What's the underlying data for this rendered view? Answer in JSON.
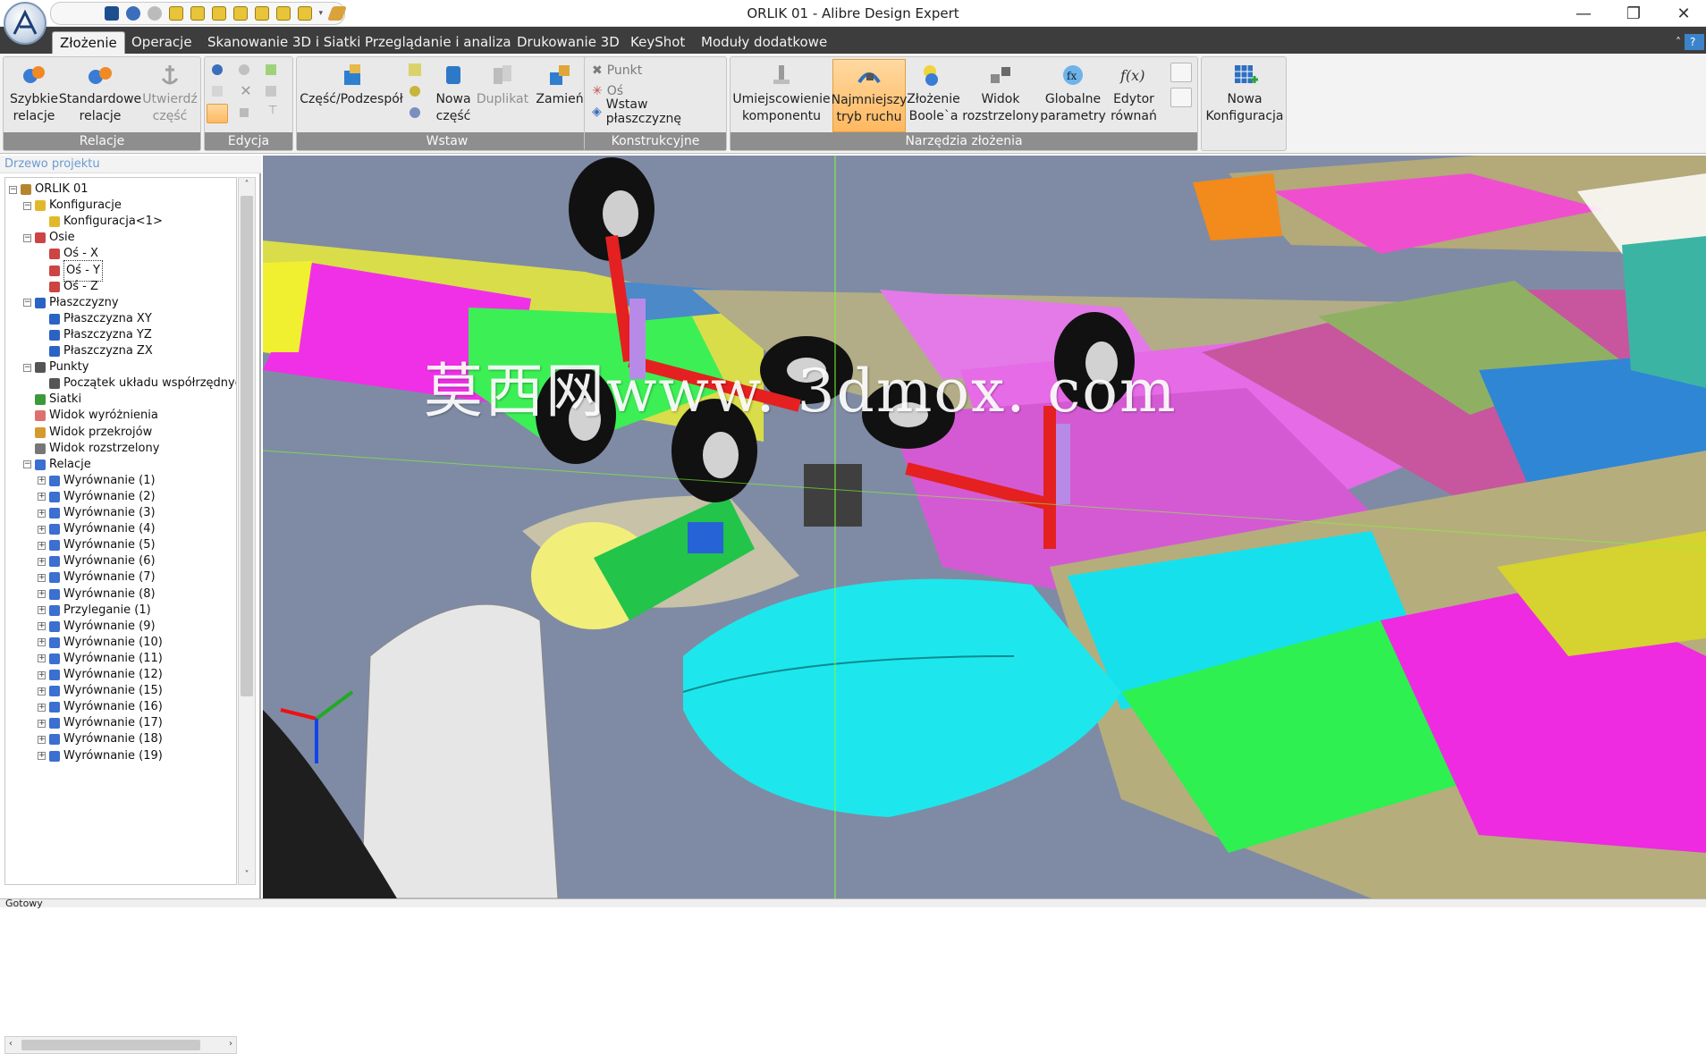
{
  "window": {
    "title": "ORLIK 01 - Alibre Design Expert",
    "minimize_glyph": "—",
    "maximize_glyph": "❐",
    "close_glyph": "✕"
  },
  "menu": {
    "tabs": [
      {
        "label": "Złożenie",
        "active": true
      },
      {
        "label": "Operacje"
      },
      {
        "label": "Skanowanie 3D i Siatki"
      },
      {
        "label": "Przeglądanie i analiza"
      },
      {
        "label": "Drukowanie 3D"
      },
      {
        "label": "KeyShot"
      },
      {
        "label": "Moduły dodatkowe"
      }
    ],
    "collapse_glyph": "˄",
    "help_glyph": "?"
  },
  "ribbon": {
    "groups": {
      "relacje": {
        "title": "Relacje",
        "quick": "Szybkie relacje",
        "standard": "Standardowe relacje",
        "anchor": "Utwierdź część"
      },
      "edycja": {
        "title": "Edycja"
      },
      "wstaw": {
        "title": "Wstaw",
        "part_subassembly": "Część/Podzespół",
        "new_part": "Nowa część",
        "duplicate": "Duplikat",
        "replace": "Zamień"
      },
      "konstrukcyjne": {
        "title": "Konstrukcyjne",
        "point": "Punkt",
        "axis": "Oś",
        "plane": "Wstaw płaszczyznę"
      },
      "narzedzia": {
        "title": "Narzędzia złożenia",
        "place": "Umiejscowienie komponentu",
        "min_motion": "Najmniejszy tryb ruchu",
        "boolean": "Złożenie Boole`a",
        "exploded": "Widok rozstrzelony",
        "global": "Globalne parametry",
        "equation": "Edytor równań"
      },
      "konfiguracja": {
        "new_config": "Nowa Konfiguracja"
      }
    }
  },
  "panel": {
    "title": "Drzewo projektu",
    "tree": [
      {
        "label": "ORLIK 01",
        "level": 0,
        "expander": "−",
        "icon": "assembly-icon"
      },
      {
        "label": "Konfiguracje",
        "level": 1,
        "expander": "−",
        "icon": "configuration-icon"
      },
      {
        "label": "Konfiguracja<1>",
        "level": 2,
        "icon": "configuration-icon"
      },
      {
        "label": "Osie",
        "level": 1,
        "expander": "−",
        "icon": "axis-icon"
      },
      {
        "label": "Oś - X",
        "level": 2,
        "icon": "axis-icon"
      },
      {
        "label": "Oś - Y",
        "level": 2,
        "icon": "axis-icon",
        "selected": true
      },
      {
        "label": "Oś - Z",
        "level": 2,
        "icon": "axis-icon"
      },
      {
        "label": "Płaszczyzny",
        "level": 1,
        "expander": "−",
        "icon": "plane-icon"
      },
      {
        "label": "Płaszczyzna XY",
        "level": 2,
        "icon": "plane-icon"
      },
      {
        "label": "Płaszczyzna YZ",
        "level": 2,
        "icon": "plane-icon"
      },
      {
        "label": "Płaszczyzna ZX",
        "level": 2,
        "icon": "plane-icon"
      },
      {
        "label": "Punkty",
        "level": 1,
        "expander": "−",
        "icon": "point-icon"
      },
      {
        "label": "Początek układu współrzędnyc",
        "level": 2,
        "icon": "point-icon"
      },
      {
        "label": "Siatki",
        "level": 1,
        "icon": "mesh-icon"
      },
      {
        "label": "Widok wyróżnienia",
        "level": 1,
        "icon": "highlight-view-icon"
      },
      {
        "label": "Widok przekrojów",
        "level": 1,
        "icon": "section-view-icon"
      },
      {
        "label": "Widok rozstrzelony",
        "level": 1,
        "icon": "exploded-view-icon"
      },
      {
        "label": "Relacje",
        "level": 1,
        "expander": "−",
        "icon": "constraint-icon"
      },
      {
        "label": "Wyrównanie (1)",
        "level": 2,
        "expander": "+",
        "icon": "constraint-icon"
      },
      {
        "label": "Wyrównanie (2)",
        "level": 2,
        "expander": "+",
        "icon": "constraint-icon"
      },
      {
        "label": "Wyrównanie (3)",
        "level": 2,
        "expander": "+",
        "icon": "constraint-icon"
      },
      {
        "label": "Wyrównanie (4)",
        "level": 2,
        "expander": "+",
        "icon": "constraint-icon"
      },
      {
        "label": "Wyrównanie (5)",
        "level": 2,
        "expander": "+",
        "icon": "constraint-icon"
      },
      {
        "label": "Wyrównanie (6)",
        "level": 2,
        "expander": "+",
        "icon": "constraint-icon"
      },
      {
        "label": "Wyrównanie (7)",
        "level": 2,
        "expander": "+",
        "icon": "constraint-icon"
      },
      {
        "label": "Wyrównanie (8)",
        "level": 2,
        "expander": "+",
        "icon": "constraint-icon"
      },
      {
        "label": "Przyleganie (1)",
        "level": 2,
        "expander": "+",
        "icon": "constraint-icon"
      },
      {
        "label": "Wyrównanie (9)",
        "level": 2,
        "expander": "+",
        "icon": "constraint-icon"
      },
      {
        "label": "Wyrównanie (10)",
        "level": 2,
        "expander": "+",
        "icon": "constraint-icon"
      },
      {
        "label": "Wyrównanie (11)",
        "level": 2,
        "expander": "+",
        "icon": "constraint-icon"
      },
      {
        "label": "Wyrównanie (12)",
        "level": 2,
        "expander": "+",
        "icon": "constraint-icon"
      },
      {
        "label": "Wyrównanie (15)",
        "level": 2,
        "expander": "+",
        "icon": "constraint-icon"
      },
      {
        "label": "Wyrównanie (16)",
        "level": 2,
        "expander": "+",
        "icon": "constraint-icon"
      },
      {
        "label": "Wyrównanie (17)",
        "level": 2,
        "expander": "+",
        "icon": "constraint-icon"
      },
      {
        "label": "Wyrównanie (18)",
        "level": 2,
        "expander": "+",
        "icon": "constraint-icon"
      },
      {
        "label": "Wyrównanie (19)",
        "level": 2,
        "expander": "+",
        "icon": "constraint-icon"
      }
    ]
  },
  "viewport": {
    "watermark": "莫西网www. 3dmox. com"
  },
  "status": {
    "text": "Gotowy"
  },
  "colors": {
    "menubar": "#3d3d3d",
    "ribbon_group_title": "#8e8e8e",
    "highlight_button": "#ffb860",
    "panel_title": "#6a9bd1",
    "viewport_bg": "#7e8aa3"
  }
}
